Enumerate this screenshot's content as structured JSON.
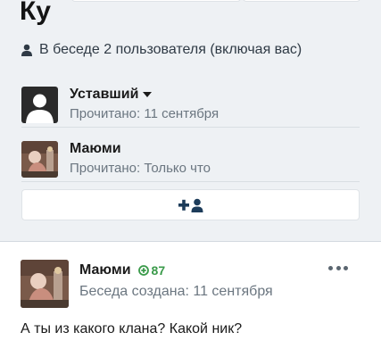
{
  "conversation": {
    "title": "Ку",
    "participants_text": "В беседе 2 пользователя (включая вас)"
  },
  "members": [
    {
      "name": "Уставший",
      "read_text": "Прочитано: 11 сентября"
    },
    {
      "name": "Маюми",
      "read_text": "Прочитано: Только что"
    }
  ],
  "message": {
    "author": "Маюми",
    "reputation": "87",
    "meta": "Беседа создана: 11 сентября",
    "text": "А ты из какого клана? Какой ник?"
  },
  "colors": {
    "background": "#eef1f4",
    "accent": "#1d3c5a",
    "reputation_green": "#3a9a4a"
  },
  "icons": {
    "participants": "user-icon",
    "invite": "add-user-icon",
    "reputation": "plus-circle-icon",
    "menu": "more-dots-icon",
    "dropdown": "caret-down-icon"
  }
}
